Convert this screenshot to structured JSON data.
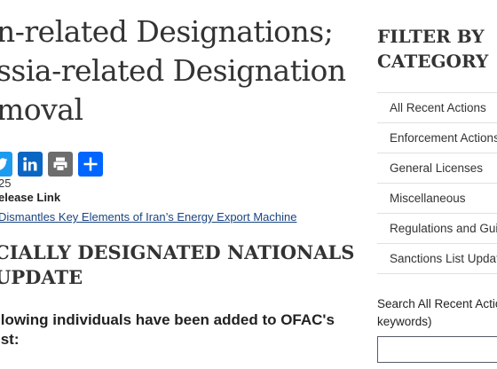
{
  "article": {
    "title_lines": [
      "n-related Designations;",
      "ssia-related Designation",
      "moval"
    ],
    "share": {
      "icons": [
        "twitter-icon",
        "linkedin-icon",
        "print-icon",
        "share-icon"
      ],
      "colors": {
        "twitter": "#1d9bf0",
        "linkedin": "#0a66c2",
        "print": "#6d6d6d",
        "share": "#0166ff"
      }
    },
    "date": "25",
    "release_link_label": "elease Link",
    "related_link": "Dismantles Key Elements of Iran’s Energy Export Machine",
    "section_heading_lines": [
      "CIALLY DESIGNATED NATIONALS",
      "UPDATE"
    ],
    "paragraph_lines": [
      "llowing individuals have been added to OFAC's",
      "ist:"
    ]
  },
  "sidebar": {
    "filter_title_lines": [
      "FILTER BY",
      "CATEGORY"
    ],
    "categories": [
      "All Recent Actions",
      "Enforcement Actions",
      "General Licenses",
      "Miscellaneous",
      "Regulations and Guidance",
      "Sanctions List Updates"
    ],
    "search_label_lines": [
      "Search All Recent Actions",
      "keywords)"
    ],
    "search_value": ""
  }
}
